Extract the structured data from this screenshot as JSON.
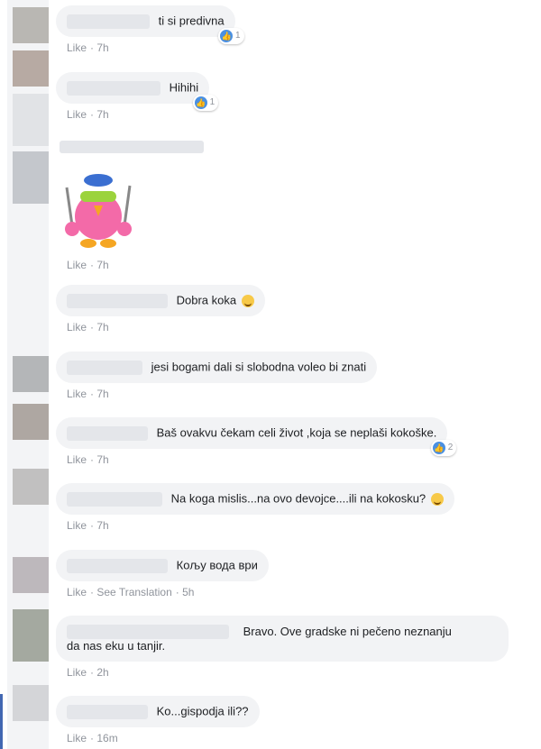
{
  "like_label": "Like",
  "see_translation": "See Translation",
  "comments": [
    {
      "text": "ti si predivna",
      "time": "7h",
      "reactions": "1"
    },
    {
      "text": "Hihihi",
      "time": "7h",
      "reactions": "1"
    },
    {
      "time": "7h"
    },
    {
      "text": "Dobra koka",
      "time": "7h"
    },
    {
      "text": "jesi bogami dali si slobodna voleo bi znati",
      "time": "7h"
    },
    {
      "text": "Baš ovakvu čekam celi život ,koja se neplaši kokoške.",
      "time": "7h",
      "reactions": "2"
    },
    {
      "text": "Na koga mislis...na ovo devojce....ili na kokosku?",
      "time": "7h"
    },
    {
      "text": "Кољу вода ври",
      "time": "5h"
    },
    {
      "text_line1": "Bravo. Ove gradske ni pečeno neznanju",
      "text_line2": "da nas eku u tanjir.",
      "time": "2h"
    },
    {
      "text": "Ko...gispodja ili??",
      "time": "16m"
    }
  ],
  "icons": {
    "like": "like-icon",
    "laugh": "laughing-emoji-icon",
    "smile": "smiling-emoji-icon",
    "sticker": "chicken-sticker"
  },
  "colors": {
    "bubble": "#f2f3f5",
    "meta": "#90949c",
    "like_blue": "#4a90e2"
  }
}
